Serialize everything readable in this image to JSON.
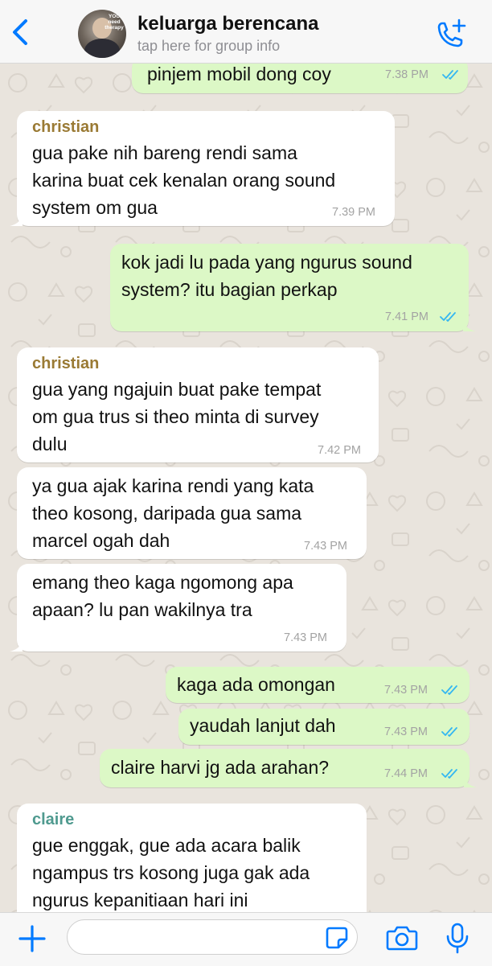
{
  "header": {
    "title": "keluarga berencana",
    "subtitle": "tap here for group info",
    "avatar_caption": "YOU need therapy"
  },
  "colors": {
    "accent": "#007aff",
    "outgoing_bubble": "#dcf8c6",
    "incoming_bubble": "#ffffff",
    "read_ticks": "#34b7f1",
    "sender_christian": "#9a7a34",
    "sender_claire": "#4f9a8f"
  },
  "icons": [
    "back-chevron-icon",
    "add-call-icon",
    "plus-icon",
    "sticker-icon",
    "camera-icon",
    "microphone-icon"
  ],
  "messages": [
    {
      "dir": "out",
      "text": "pinjem mobil dong coy",
      "time": "7.38 PM",
      "read": true
    },
    {
      "dir": "in",
      "sender": "christian",
      "text": "gua pake nih bareng rendi sama\nkarina buat cek kenalan orang sound\nsystem om gua",
      "time": "7.39 PM"
    },
    {
      "dir": "out",
      "text": "kok jadi lu pada yang ngurus sound\nsystem? itu bagian perkap",
      "time": "7.41 PM",
      "read": true
    },
    {
      "dir": "in",
      "sender": "christian",
      "text": "gua yang ngajuin buat pake tempat\nom gua trus si theo minta di survey\ndulu",
      "time": "7.42 PM"
    },
    {
      "dir": "in",
      "text": "ya gua ajak karina rendi yang kata\ntheo kosong, daripada gua sama\nmarcel ogah dah",
      "time": "7.43 PM"
    },
    {
      "dir": "in",
      "text": "emang theo kaga ngomong apa\napaan? lu pan wakilnya tra",
      "time": "7.43 PM"
    },
    {
      "dir": "out",
      "text": "kaga ada omongan",
      "time": "7.43 PM",
      "read": true
    },
    {
      "dir": "out",
      "text": "yaudah lanjut dah",
      "time": "7.43 PM",
      "read": true
    },
    {
      "dir": "out",
      "text": "claire harvi jg ada arahan?",
      "time": "7.44 PM",
      "read": true
    },
    {
      "dir": "in",
      "sender": "claire",
      "text": "gue enggak, gue ada acara balik\nngampus trs kosong juga gak ada\nngurus kepanitiaan hari ini",
      "time": ""
    }
  ],
  "composer": {
    "value": "",
    "placeholder": ""
  }
}
